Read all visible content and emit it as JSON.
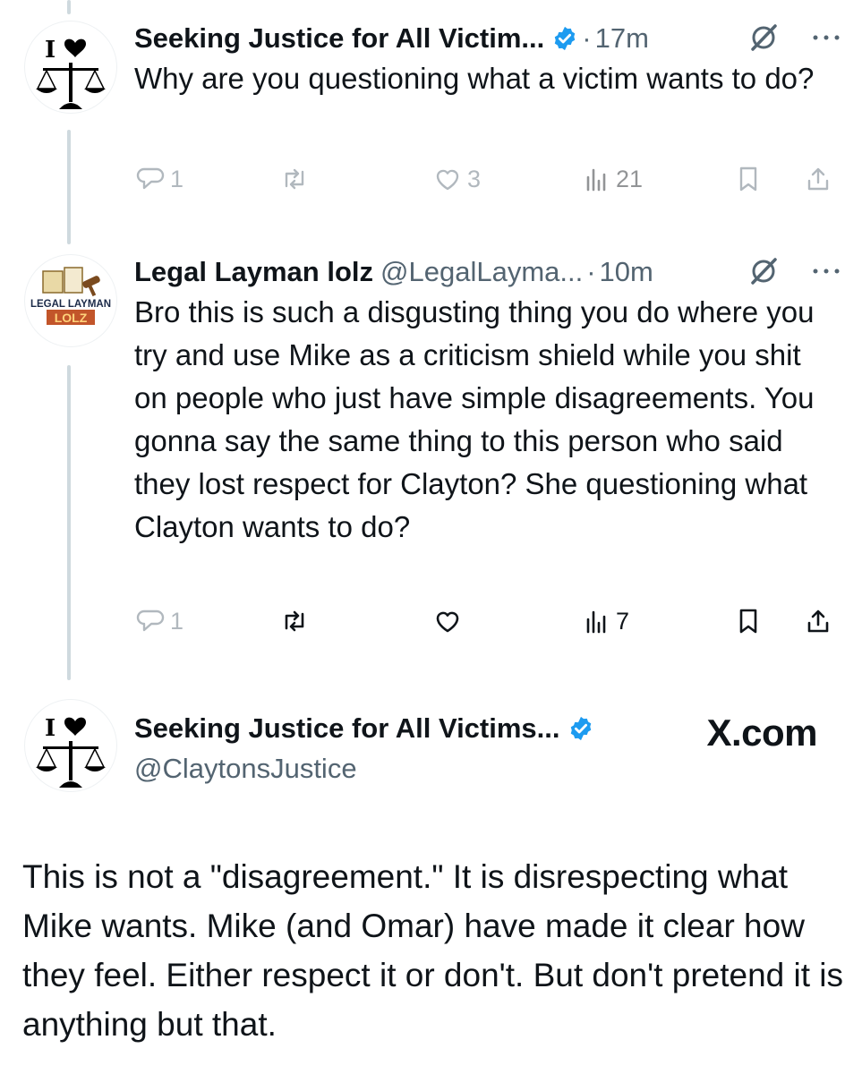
{
  "tweets": [
    {
      "name": "Seeking Justice for All Victim...",
      "time": "17m",
      "verified": true,
      "text": "Why are you questioning what a victim wants to do?",
      "replies": "1",
      "retweets": "",
      "likes": "3",
      "views": "21",
      "avatar_icon": "i-love-justice-scales-icon"
    },
    {
      "name": "Legal Layman lolz",
      "handle": "@LegalLayma...",
      "time": "10m",
      "verified": false,
      "text": "Bro this is such a disgusting thing you do where you try and use Mike as a criticism shield while you shit on people who just have simple disagreements. You gonna say the same thing to this person who  said they lost respect for Clayton? She questioning what Clayton wants to do?",
      "replies": "1",
      "retweets": "",
      "likes": "",
      "views": "7",
      "avatar_icon": "legal-layman-logo",
      "avatar_text": [
        "LEGAL LAYMAN",
        "LOLZ"
      ]
    }
  ],
  "quoted": {
    "name": "Seeking Justice for All Victims...",
    "handle": "@ClaytonsJustice",
    "site": "X.com",
    "text": "This is not a \"disagreement.\" It is disrespecting what Mike wants. Mike (and Omar) have made it clear how they feel. Either respect it or don't. But don't pretend it is anything but that."
  },
  "colors": {
    "text": "#0f1419",
    "secondary": "#536471",
    "verified_blue": "#1d9bf0",
    "thread_line": "#cfd9de"
  }
}
